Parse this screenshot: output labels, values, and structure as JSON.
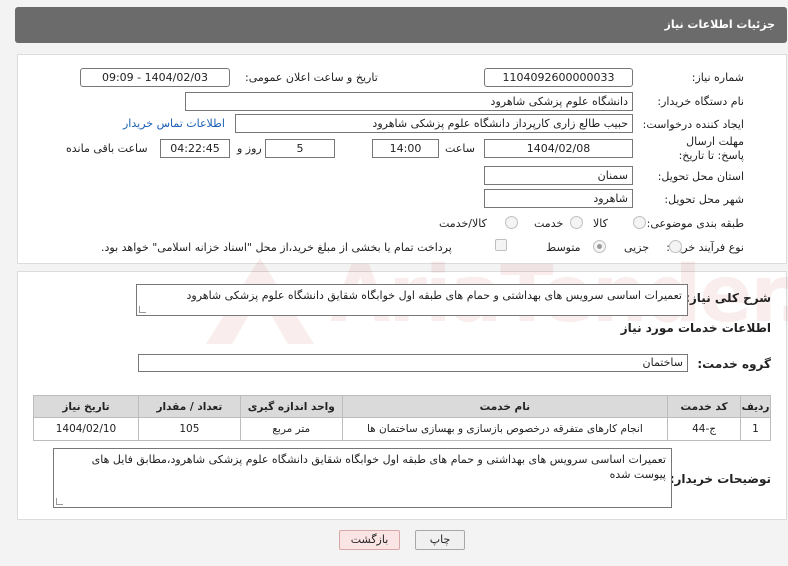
{
  "header": {
    "title": "جزئیات اطلاعات نیاز"
  },
  "form": {
    "need_number_label": "شماره نیاز:",
    "need_number": "1104092600000033",
    "announce_label": "تاریخ و ساعت اعلان عمومی:",
    "announce_value": "1404/02/03 - 09:09",
    "buyer_org_label": "نام دستگاه خریدار:",
    "buyer_org": "دانشگاه علوم پزشکی شاهرود",
    "requester_label": "ایجاد کننده درخواست:",
    "requester": "حبیب طالع زاری کارپرداز دانشگاه علوم پزشکی شاهرود",
    "buyer_contact_link": "اطلاعات تماس خریدار",
    "deadline_label": "مهلت ارسال پاسخ: تا تاریخ:",
    "deadline_date": "1404/02/08",
    "time_label": "ساعت",
    "deadline_time": "14:00",
    "days_count": "5",
    "days_label": "روز و",
    "remaining_time": "04:22:45",
    "remaining_label": "ساعت باقی مانده",
    "province_label": "استان محل تحویل:",
    "province": "سمنان",
    "city_label": "شهر محل تحویل:",
    "city": "شاهرود",
    "category_label": "طبقه بندی موضوعی:",
    "category_options": [
      "کالا",
      "خدمت",
      "کالا/خدمت"
    ],
    "purchase_type_label": "نوع فرآیند خرید :",
    "purchase_options": [
      "جزیی",
      "متوسط"
    ],
    "payment_note": "پرداخت تمام یا بخشی از مبلغ خرید،از محل \"اسناد خزانه اسلامی\" خواهد بود."
  },
  "details": {
    "summary_label": "شرح کلی نیاز:",
    "summary": "تعمیرات اساسی سرویس های بهداشتی و حمام های طبقه اول خوابگاه شقایق دانشگاه علوم پزشکی شاهرود",
    "services_heading": "اطلاعات خدمات مورد نیاز",
    "service_group_label": "گروه خدمت:",
    "service_group": "ساختمان",
    "table": {
      "headers": [
        "ردیف",
        "کد خدمت",
        "نام خدمت",
        "واحد اندازه گیری",
        "تعداد / مقدار",
        "تاریخ نیاز"
      ],
      "rows": [
        [
          "1",
          "ج-44",
          "انجام کارهای متفرقه درخصوص بازسازی و بهسازی ساختمان ها",
          "متر مربع",
          "105",
          "1404/02/10"
        ]
      ]
    },
    "buyer_notes_label": "توضیحات خریدار:",
    "buyer_notes": "تعمیرات اساسی سرویس های بهداشتی و حمام های طبقه اول خوابگاه شقایق دانشگاه علوم پزشکی شاهرود،مطابق فایل های پیوست شده"
  },
  "buttons": {
    "print": "چاپ",
    "back": "بازگشت"
  },
  "watermark": {
    "text": "AriaTender.neT"
  },
  "colors": {
    "header_bg": "#6b6b6b",
    "link": "#1a5fb4",
    "back_btn": "#fbe4e4"
  }
}
